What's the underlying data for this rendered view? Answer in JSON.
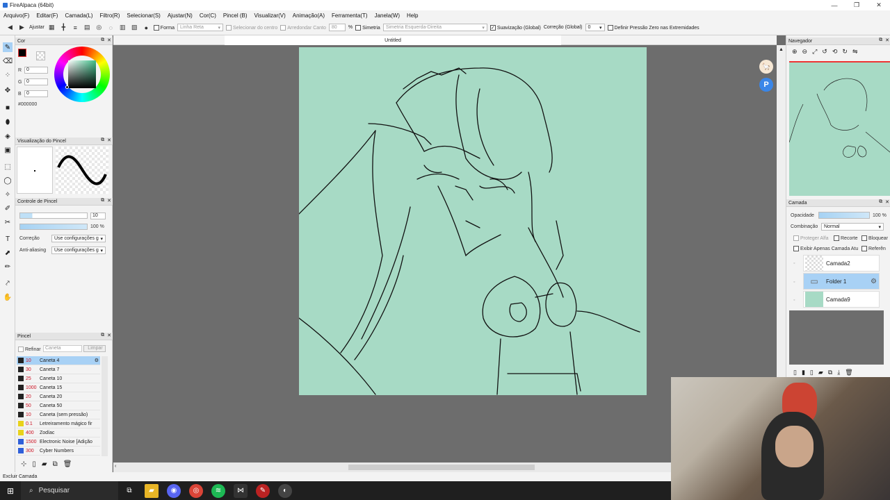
{
  "window": {
    "title": "FireAlpaca (64bit)",
    "controls": [
      "—",
      "❐",
      "✕"
    ]
  },
  "menu": [
    "Arquivo(F)",
    "Editar(F)",
    "Camada(L)",
    "Filtro(R)",
    "Selecionar(S)",
    "Ajustar(N)",
    "Cor(C)",
    "Pincel (B)",
    "Visualizar(V)",
    "Animação(A)",
    "Ferramenta(T)",
    "Janela(W)",
    "Help"
  ],
  "toolbar": {
    "ajustar": "Ajustar",
    "forma": "Forma",
    "forma_value": "Linha Reta",
    "selecionar_centro": "Selecionar do centro",
    "arredondar_canto": "Arredondar Canto",
    "arredondar_value": "80",
    "percent": "%",
    "simetria": "Simetria",
    "simetria_value": "Simetria Esquerda-Direita",
    "suavizacao": "Suavização (Global)",
    "correcao": "Correção (Global)",
    "correcao_value": "0",
    "definir_pressao": "Definir Pressão Zero nas Extremidades"
  },
  "color_panel": {
    "title": "Cor",
    "r_label": "R",
    "r_value": "0",
    "g_label": "G",
    "g_value": "0",
    "b_label": "B",
    "b_value": "0",
    "hex": "#000000"
  },
  "brush_preview": {
    "title": "Visualização do Pincel"
  },
  "brush_control": {
    "title": "Controle de Pincel",
    "size_value": "10",
    "opacity_value": "100 %",
    "correcao_label": "Correção",
    "correcao_value": "Use configurações g",
    "antialias_label": "Anti-aliasing",
    "antialias_value": "Use configurações g"
  },
  "brush_list": {
    "title": "Pincel",
    "refinar": "Refinar",
    "search_placeholder": "Caneta",
    "limpar": "Limpar",
    "items": [
      {
        "size": "10",
        "name": "Caneta 4",
        "color": "#222222"
      },
      {
        "size": "30",
        "name": "Caneta 7",
        "color": "#222222"
      },
      {
        "size": "25",
        "name": "Caneta 10",
        "color": "#222222"
      },
      {
        "size": "1000",
        "name": "Caneta 15",
        "color": "#222222"
      },
      {
        "size": "20",
        "name": "Caneta 20",
        "color": "#222222"
      },
      {
        "size": "50",
        "name": "Caneta 50",
        "color": "#222222"
      },
      {
        "size": "10",
        "name": "Caneta (sem pressão)",
        "color": "#222222"
      },
      {
        "size": "0.1",
        "name": "Letreiramento mágico fir",
        "color": "#e8d21a"
      },
      {
        "size": "400",
        "name": "Zodíac",
        "color": "#e8d21a"
      },
      {
        "size": "1500",
        "name": "Electronic Noise [Adição",
        "color": "#2f5fd9"
      },
      {
        "size": "300",
        "name": "Cyber Numbers",
        "color": "#2f5fd9"
      }
    ]
  },
  "canvas_tab": "Untitled",
  "navigator": {
    "title": "Navegador"
  },
  "layers_panel": {
    "title": "Camada",
    "opacity_label": "Opacidade",
    "opacity_value": "100 %",
    "blend_label": "Combinação",
    "blend_value": "Normal",
    "protect_alpha": "Proteger Alfa",
    "clip": "Recorte",
    "lock": "Bloquear",
    "show_only": "Exibir Apenas Camada Atu",
    "reference": "Referên",
    "layers": [
      {
        "name": "Camada2",
        "type": "layer",
        "active": false
      },
      {
        "name": "Folder 1",
        "type": "folder",
        "active": true
      },
      {
        "name": "Camada9",
        "type": "fill",
        "active": false
      }
    ]
  },
  "status": "Excluir Camada",
  "taskbar": {
    "search": "Pesquisar"
  },
  "colors": {
    "canvas": "#a7dac5",
    "selection": "#a8d1f5",
    "accent": "#3a86e8"
  }
}
